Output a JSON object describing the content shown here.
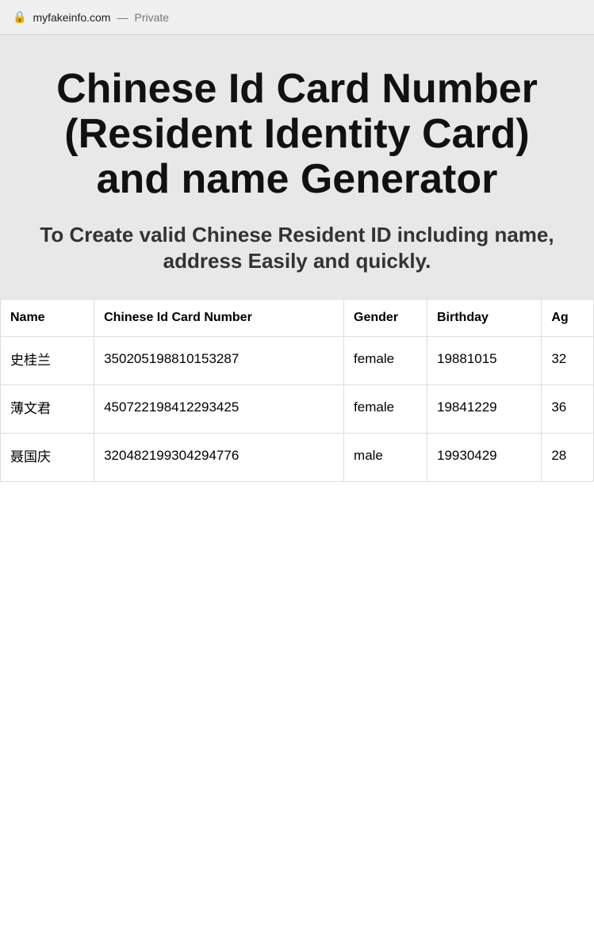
{
  "browser": {
    "lock_icon": "🔒",
    "url": "myfakeinfo.com",
    "separator": "—",
    "private_label": "Private"
  },
  "hero": {
    "title": "Chinese Id Card Number (Resident Identity Card) and name Generator",
    "subtitle": "To Create valid Chinese Resident ID including name, address Easily and quickly."
  },
  "table": {
    "columns": [
      {
        "key": "name",
        "label": "Name"
      },
      {
        "key": "id_number",
        "label": "Chinese Id Card Number"
      },
      {
        "key": "gender",
        "label": "Gender"
      },
      {
        "key": "birthday",
        "label": "Birthday"
      },
      {
        "key": "age",
        "label": "Ag"
      }
    ],
    "rows": [
      {
        "name": "史桂兰",
        "id_number": "350205198810153287",
        "gender": "female",
        "birthday": "19881015",
        "age": "32"
      },
      {
        "name": "薄文君",
        "id_number": "450722198412293425",
        "gender": "female",
        "birthday": "19841229",
        "age": "36"
      },
      {
        "name": "聂国庆",
        "id_number": "320482199304294776",
        "gender": "male",
        "birthday": "19930429",
        "age": "28"
      }
    ]
  }
}
